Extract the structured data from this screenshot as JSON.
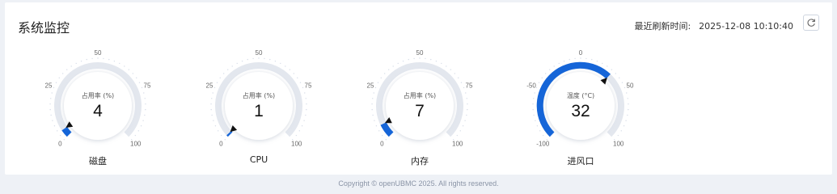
{
  "header": {
    "title": "系统监控",
    "refresh_label": "最近刷新时间:",
    "refresh_time": "2025-12-08 10:10:40"
  },
  "gauges": [
    {
      "name": "磁盘",
      "metric": "占用率 (%)",
      "value": 4,
      "min": 0,
      "max": 100,
      "ticks": [
        0,
        25,
        50,
        75,
        100
      ]
    },
    {
      "name": "CPU",
      "metric": "占用率 (%)",
      "value": 1,
      "min": 0,
      "max": 100,
      "ticks": [
        0,
        25,
        50,
        75,
        100
      ]
    },
    {
      "name": "内存",
      "metric": "占用率 (%)",
      "value": 7,
      "min": 0,
      "max": 100,
      "ticks": [
        0,
        25,
        50,
        75,
        100
      ]
    },
    {
      "name": "进风口",
      "metric": "温度 (°C)",
      "value": 32,
      "min": -100,
      "max": 100,
      "ticks": [
        -100,
        -50,
        0,
        50,
        100
      ]
    }
  ],
  "colors": {
    "accent": "#1565d8",
    "track": "#e3e7ee"
  },
  "footer": {
    "copyright": "Copyright © openUBMC 2025. All rights reserved."
  }
}
